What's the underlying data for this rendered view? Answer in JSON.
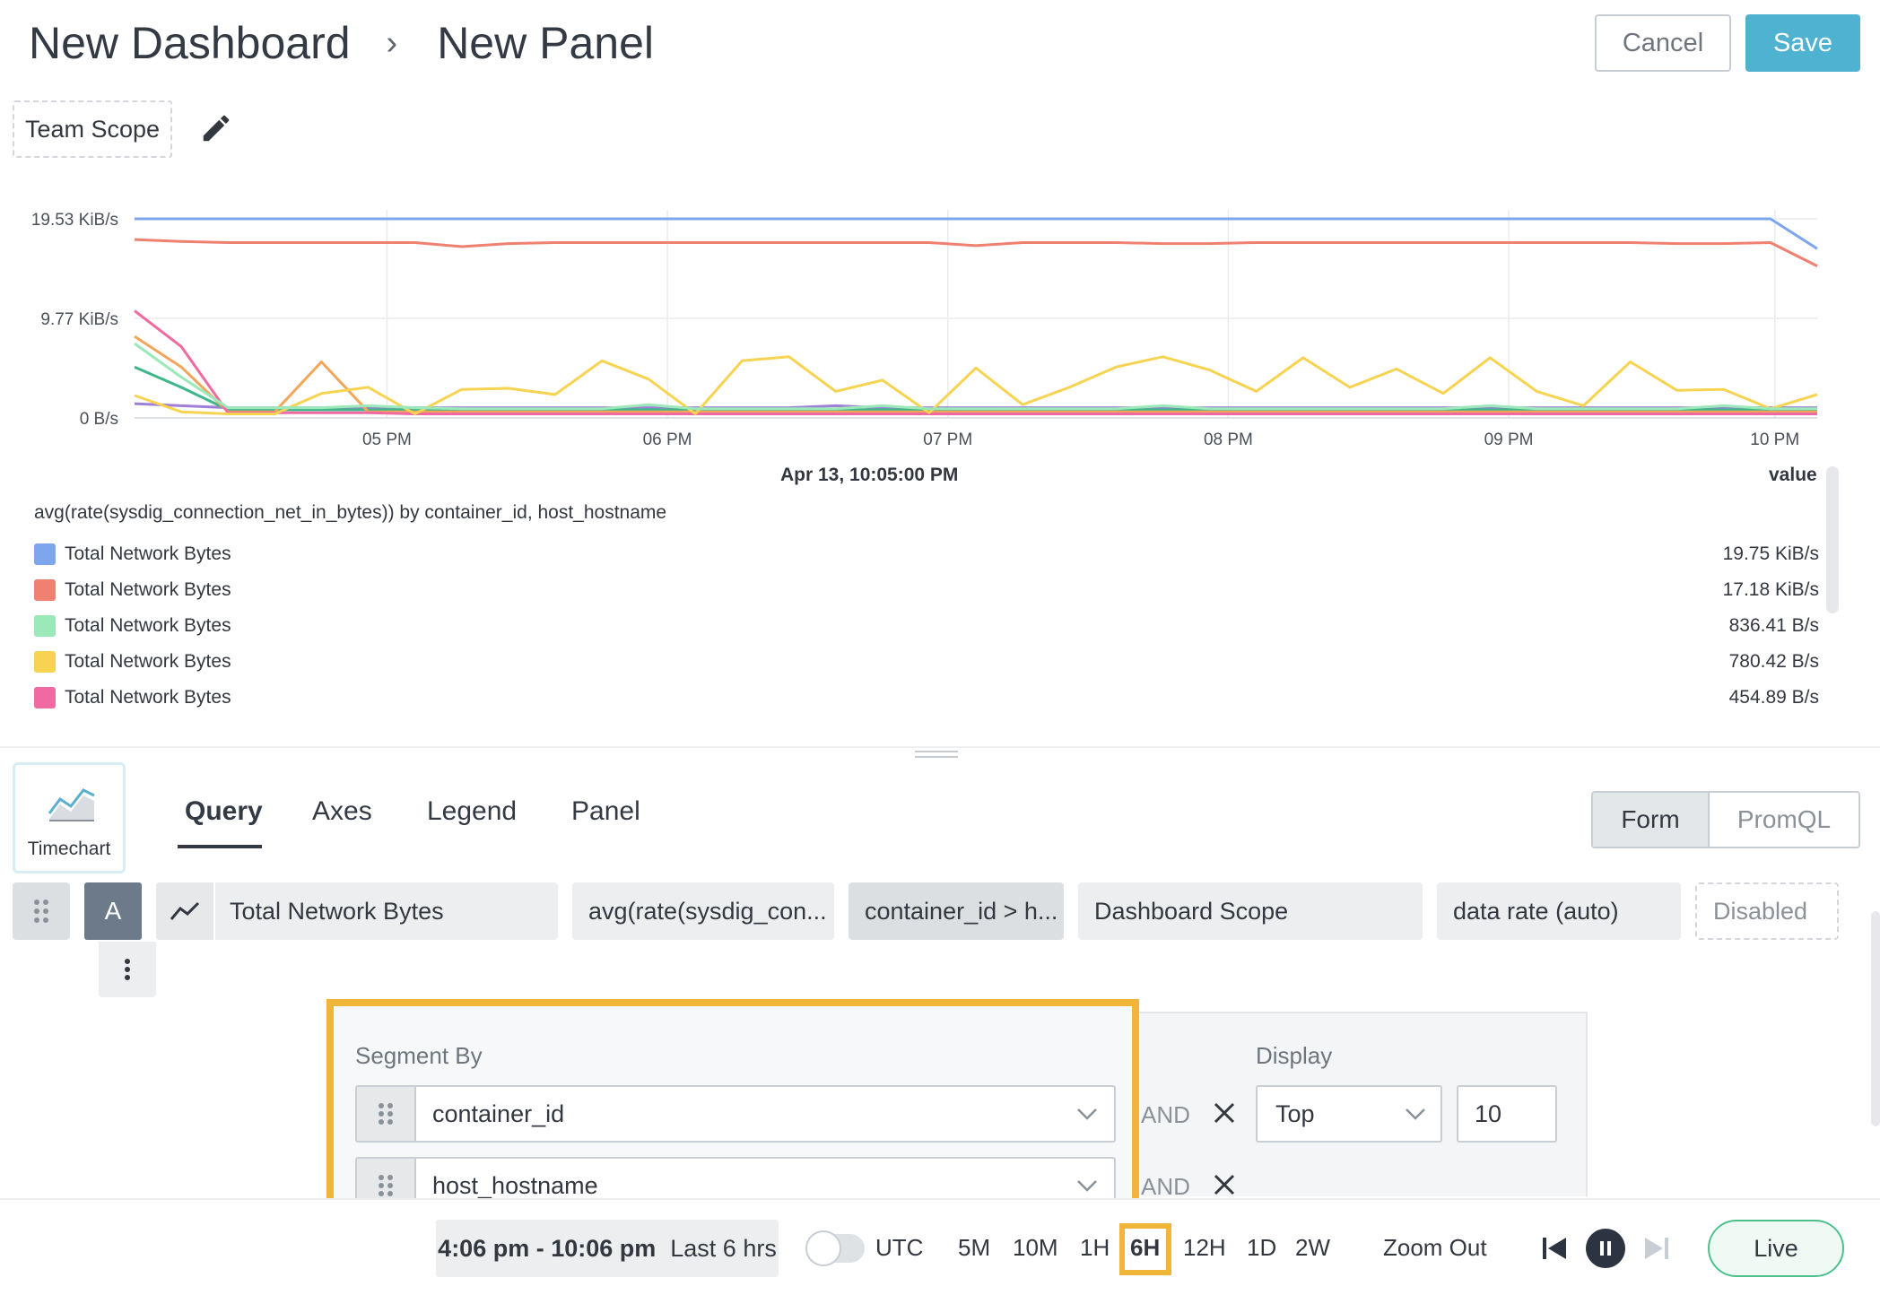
{
  "header": {
    "breadcrumb_dashboard": "New Dashboard",
    "breadcrumb_separator": "›",
    "breadcrumb_panel": "New Panel",
    "cancel_label": "Cancel",
    "save_label": "Save",
    "scope_label": "Team Scope",
    "colors": {
      "save_bg": "#4fb2d1"
    }
  },
  "chart_data": {
    "type": "line",
    "y_ticks": [
      "19.53 KiB/s",
      "9.77 KiB/s",
      "0 B/s"
    ],
    "x_ticks": [
      "05 PM",
      "06 PM",
      "07 PM",
      "08 PM",
      "09 PM",
      "10 PM"
    ],
    "ylim_kib": [
      0,
      19.53
    ],
    "x_range": [
      "4:06 pm",
      "10:06 pm"
    ],
    "grid": true,
    "series": [
      {
        "color": "#7ea6ec",
        "values": [
          19.7,
          19.7,
          19.7,
          19.7,
          19.7,
          19.7,
          19.7,
          19.7,
          19.7,
          19.7,
          19.7,
          19.7,
          19.7,
          19.7,
          19.7,
          19.7,
          19.7,
          19.7,
          19.7,
          19.7,
          19.7,
          19.7,
          19.7,
          19.7,
          19.7,
          19.7,
          19.7,
          19.7,
          19.7,
          19.7,
          19.7,
          19.7,
          19.7,
          19.7,
          19.7,
          19.7,
          16.6
        ]
      },
      {
        "color": "#f08070",
        "values": [
          17.5,
          17.3,
          17.2,
          17.2,
          17.2,
          17.2,
          17.2,
          16.8,
          17.1,
          17.2,
          17.2,
          17.2,
          17.2,
          17.2,
          17.2,
          17.2,
          17.2,
          17.2,
          16.9,
          17.2,
          17.2,
          17.2,
          17.1,
          17.1,
          17.2,
          17.2,
          17.2,
          17.2,
          17.2,
          17.2,
          17.2,
          17.2,
          17.2,
          17.1,
          17.1,
          17.2,
          14.9
        ]
      },
      {
        "color": "#9be8b8",
        "values": [
          7.3,
          4.0,
          1.0,
          1.0,
          1.0,
          1.2,
          1.0,
          0.9,
          0.9,
          0.9,
          0.9,
          1.3,
          0.9,
          0.9,
          0.9,
          0.9,
          1.2,
          0.9,
          0.9,
          0.9,
          0.9,
          0.9,
          1.2,
          0.9,
          0.9,
          0.9,
          0.9,
          0.9,
          0.9,
          1.2,
          0.9,
          0.9,
          0.9,
          0.9,
          1.2,
          0.9,
          0.9
        ]
      },
      {
        "color": "#f7d352",
        "values": [
          2.2,
          0.6,
          0.4,
          0.4,
          2.4,
          3.0,
          0.4,
          2.8,
          2.9,
          2.3,
          5.6,
          3.8,
          0.4,
          5.6,
          6.0,
          2.6,
          3.7,
          0.5,
          4.9,
          1.3,
          3.0,
          5.0,
          6.0,
          4.7,
          2.6,
          5.9,
          3.0,
          4.8,
          2.4,
          5.9,
          2.6,
          1.2,
          5.5,
          2.7,
          2.8,
          0.9,
          2.3
        ]
      },
      {
        "color": "#ef6aa0",
        "values": [
          10.5,
          7.0,
          0.5,
          0.5,
          0.5,
          0.5,
          0.4,
          0.4,
          0.4,
          0.4,
          0.4,
          0.4,
          0.4,
          0.4,
          0.4,
          0.4,
          0.4,
          0.4,
          0.4,
          0.4,
          0.4,
          0.4,
          0.4,
          0.4,
          0.4,
          0.4,
          0.4,
          0.4,
          0.4,
          0.4,
          0.4,
          0.4,
          0.4,
          0.4,
          0.4,
          0.4,
          0.4
        ]
      },
      {
        "color": "#f2a65a",
        "values": [
          8.0,
          5.0,
          0.6,
          0.6,
          5.5,
          0.6,
          0.6,
          0.6,
          0.6,
          0.6,
          0.6,
          0.6,
          0.6,
          0.6,
          0.6,
          0.6,
          0.6,
          0.6,
          0.6,
          0.6,
          0.6,
          0.6,
          0.6,
          0.6,
          0.6,
          0.6,
          0.6,
          0.6,
          0.6,
          0.6,
          0.6,
          0.6,
          0.6,
          0.6,
          0.6,
          0.6,
          0.6
        ]
      },
      {
        "color": "#3fb68a",
        "values": [
          5.0,
          3.0,
          0.8,
          0.8,
          0.8,
          0.8,
          0.8,
          0.8,
          0.8,
          0.8,
          0.8,
          0.8,
          0.8,
          0.8,
          0.8,
          0.8,
          0.8,
          0.8,
          0.8,
          0.8,
          0.8,
          0.8,
          0.8,
          0.8,
          0.8,
          0.8,
          0.8,
          0.8,
          0.8,
          0.8,
          0.8,
          0.8,
          0.8,
          0.8,
          0.8,
          0.8,
          0.8
        ]
      },
      {
        "color": "#a07fd8",
        "values": [
          1.4,
          1.2,
          1.0,
          1.0,
          1.0,
          1.0,
          1.0,
          1.0,
          1.0,
          1.0,
          1.0,
          1.0,
          1.0,
          1.0,
          1.0,
          1.2,
          1.0,
          1.0,
          1.0,
          1.0,
          1.0,
          1.0,
          1.0,
          1.0,
          1.0,
          1.0,
          1.0,
          1.0,
          1.0,
          1.0,
          1.0,
          1.0,
          1.0,
          1.0,
          1.0,
          1.0,
          1.0
        ]
      }
    ]
  },
  "legend": {
    "hover_time": "Apr 13, 10:05:00 PM",
    "value_header": "value",
    "query": "avg(rate(sysdig_connection_net_in_bytes)) by container_id, host_hostname",
    "items": [
      {
        "name": "Total Network Bytes",
        "value": "19.75 KiB/s",
        "color": "#7ea6ec"
      },
      {
        "name": "Total Network Bytes",
        "value": "17.18 KiB/s",
        "color": "#f08070"
      },
      {
        "name": "Total Network Bytes",
        "value": "836.41 B/s",
        "color": "#9be8b8"
      },
      {
        "name": "Total Network Bytes",
        "value": "780.42 B/s",
        "color": "#f7d352"
      },
      {
        "name": "Total Network Bytes",
        "value": "454.89 B/s",
        "color": "#ef6aa0"
      }
    ]
  },
  "editor": {
    "viz_label": "Timechart",
    "tabs": [
      "Query",
      "Axes",
      "Legend",
      "Panel"
    ],
    "mode_form": "Form",
    "mode_promql": "PromQL",
    "query": {
      "letter": "A",
      "metric_name": "Total Network Bytes",
      "metric_expr": "avg(rate(sysdig_con...",
      "segments": "container_id > h...",
      "scope": "Dashboard Scope",
      "unit": "data rate (auto)",
      "alert": "Disabled"
    },
    "segment_by_label": "Segment By",
    "segment_by": [
      "container_id",
      "host_hostname"
    ],
    "and_label": "AND",
    "display_label": "Display",
    "display_value": "Top",
    "display_limit": "10",
    "colors": {
      "highlight": "#f0b63a"
    }
  },
  "timebar": {
    "range": "4:06 pm - 10:06 pm",
    "range_desc": "Last 6 hrs",
    "utc_label": "UTC",
    "zooms": [
      "5M",
      "10M",
      "1H",
      "6H",
      "12H",
      "1D",
      "2W"
    ],
    "active_zoom": "6H",
    "zoom_out": "Zoom Out",
    "live_label": "Live",
    "colors": {
      "live_border": "#4fc08d"
    }
  }
}
